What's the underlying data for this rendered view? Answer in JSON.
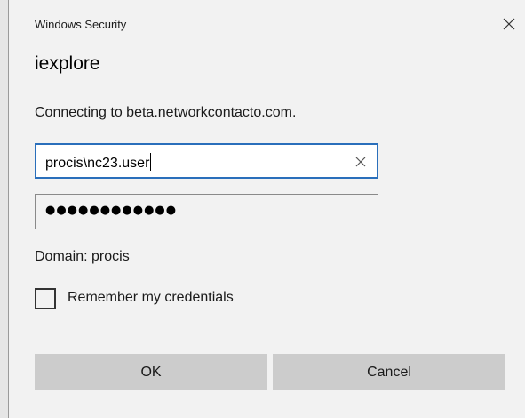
{
  "dialog": {
    "window_title": "Windows Security",
    "app_name": "iexplore",
    "message": "Connecting to beta.networkcontacto.com.",
    "close_icon": "close-icon"
  },
  "credentials": {
    "username_value": "procis\\nc23.user",
    "clear_icon": "clear-icon",
    "password_mask": "●●●●●●●●●●●●",
    "domain_text": "Domain: procis",
    "remember_label": "Remember my credentials",
    "remember_checked": false
  },
  "buttons": {
    "ok_label": "OK",
    "cancel_label": "Cancel"
  },
  "colors": {
    "focus_border": "#2a6fbb",
    "button_bg": "#cccccc",
    "dialog_bg": "#f2f2f2"
  }
}
